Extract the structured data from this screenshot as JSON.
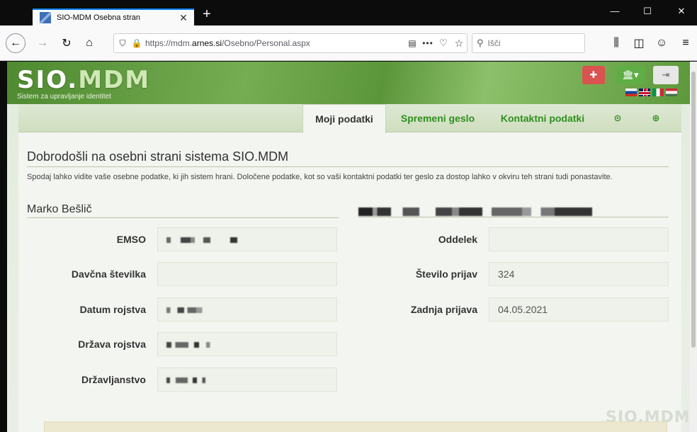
{
  "browser": {
    "tab_title": "SIO-MDM Osebna stran",
    "tab_close": "✕",
    "new_tab": "+",
    "url_scheme": "https://mdm.",
    "url_host": "arnes.si",
    "url_path": "/Osebno/Personal.aspx",
    "search_placeholder": "Išči",
    "window_controls": [
      "—",
      "☐",
      "✕"
    ]
  },
  "header": {
    "logo_main": "SIO.",
    "logo_accent": "MDM",
    "tagline": "Sistem za upravljanje identitet",
    "languages": [
      "sl",
      "en",
      "it",
      "hu"
    ]
  },
  "tabs": [
    {
      "label": "Moji podatki",
      "active": true
    },
    {
      "label": "Spremeni geslo",
      "active": false
    },
    {
      "label": "Kontaktni podatki",
      "active": false
    }
  ],
  "tab_icons": [
    "history-icon",
    "help-icon"
  ],
  "main": {
    "welcome_title": "Dobrodošli na osebni strani sistema SIO.MDM",
    "intro_text": "Spodaj lahko vidite vaše osebne podatke, ki jih sistem hrani. Določene podatke, kot so vaši kontaktni podatki ter geslo za dostop lahko v okviru teh strani tudi ponastavite.",
    "person_name": "Marko Bešlič"
  },
  "left_fields": [
    {
      "label": "EMSO",
      "value": ""
    },
    {
      "label": "Davčna številka",
      "value": ""
    },
    {
      "label": "Datum rojstva",
      "value": ""
    },
    {
      "label": "Država rojstva",
      "value": ""
    },
    {
      "label": "Državljanstvo",
      "value": ""
    }
  ],
  "right_fields": [
    {
      "label": "Oddelek",
      "value": ""
    },
    {
      "label": "Število prijav",
      "value": "324"
    },
    {
      "label": "Zadnja prijava",
      "value": "04.05.2021"
    }
  ],
  "watermark": "SIO.MDM",
  "colors": {
    "brand_green": "#5a9539",
    "link_green": "#2f8f1f",
    "support_red": "#d9534f"
  }
}
